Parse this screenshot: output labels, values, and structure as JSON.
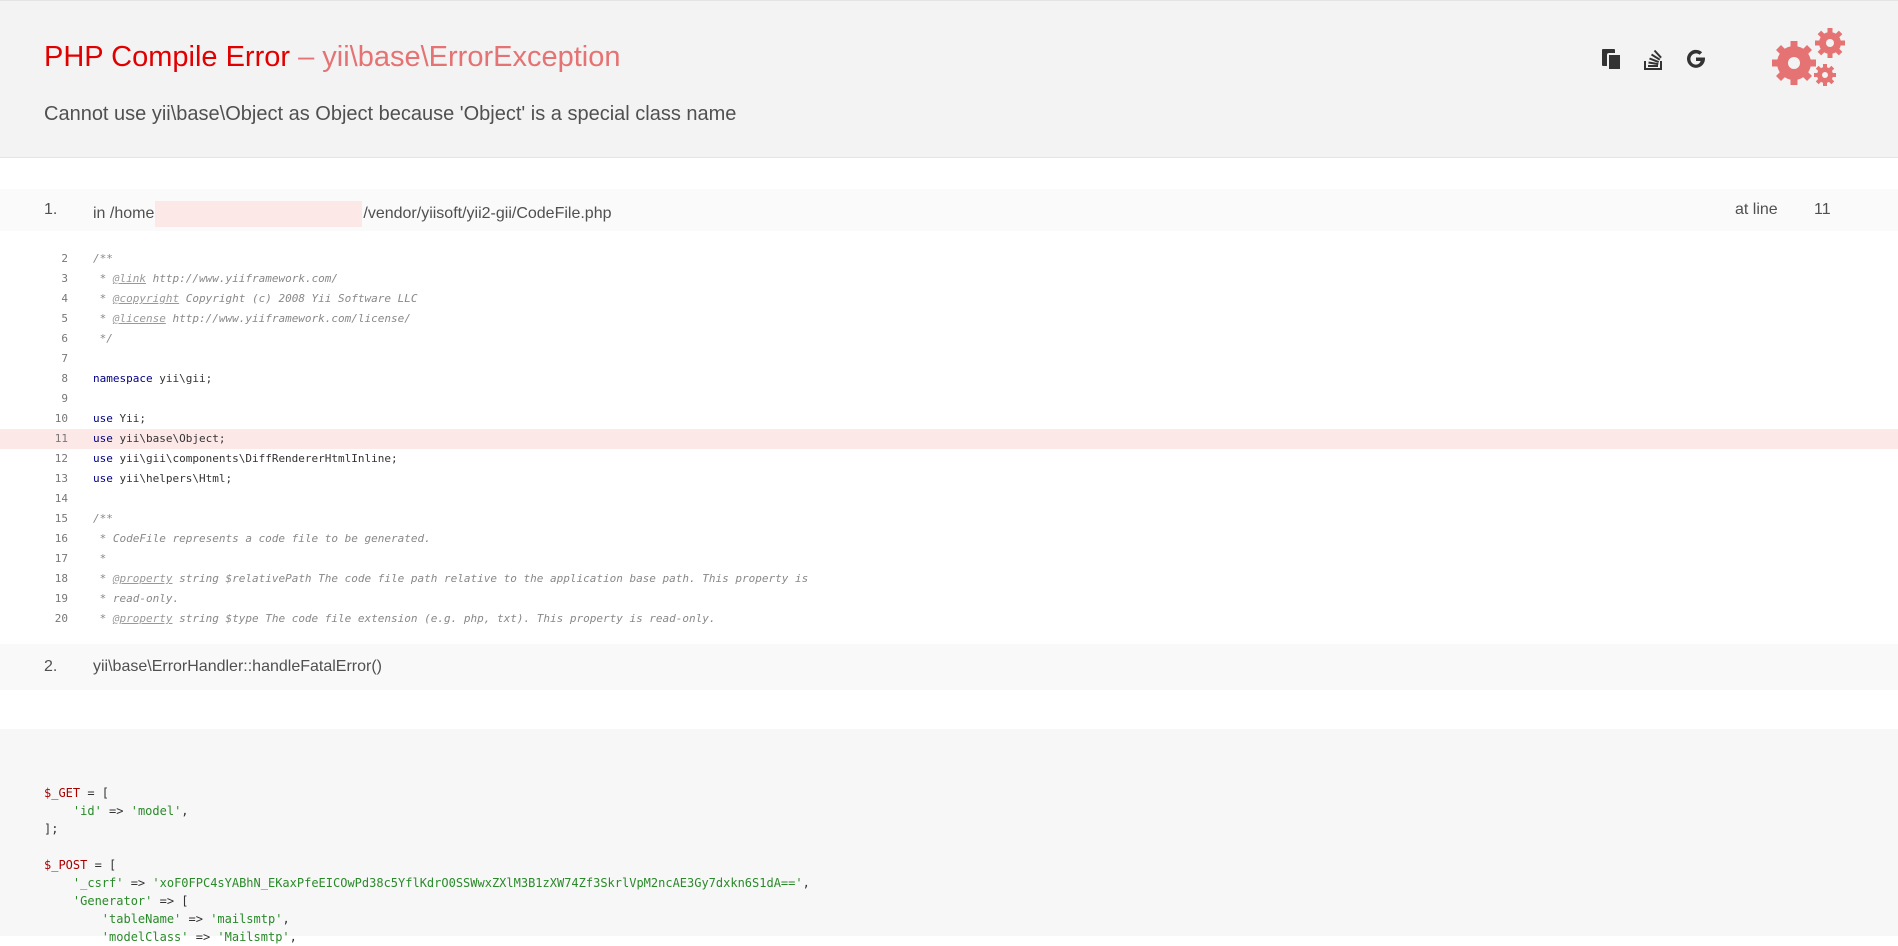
{
  "error": {
    "type": "PHP Compile Error",
    "separator": " – ",
    "exception_class": "yii\\base\\ErrorException",
    "message": "Cannot use yii\\base\\Object as Object because 'Object' is a special class name"
  },
  "toolbar": {
    "copy_icon": "copy-icon",
    "stackoverflow_icon": "stackoverflow-icon",
    "google_icon": "google-icon",
    "gears_icon": "gears-icon"
  },
  "call_stack": [
    {
      "number": "1.",
      "prefix": "in /home",
      "suffix": "/vendor/yiisoft/yii2-gii/CodeFile.php",
      "at_line_label": "at line",
      "line": "11"
    },
    {
      "number": "2.",
      "text": "yii\\base\\ErrorHandler::handleFatalError()"
    }
  ],
  "code_lines": [
    {
      "n": "2",
      "pre": "",
      "kw": "",
      "rest": "",
      "cm": "/**",
      "tag": "",
      "after": ""
    },
    {
      "n": "3",
      "pre": "",
      "kw": "",
      "rest": "",
      "cm": " * ",
      "tag": "@link",
      "after": " http://www.yiiframework.com/"
    },
    {
      "n": "4",
      "pre": "",
      "kw": "",
      "rest": "",
      "cm": " * ",
      "tag": "@copyright",
      "after": " Copyright (c) 2008 Yii Software LLC"
    },
    {
      "n": "5",
      "pre": "",
      "kw": "",
      "rest": "",
      "cm": " * ",
      "tag": "@license",
      "after": " http://www.yiiframework.com/license/"
    },
    {
      "n": "6",
      "pre": "",
      "kw": "",
      "rest": "",
      "cm": " */",
      "tag": "",
      "after": ""
    },
    {
      "n": "7",
      "pre": "",
      "kw": "",
      "rest": "",
      "cm": "",
      "tag": "",
      "after": ""
    },
    {
      "n": "8",
      "pre": "",
      "kw": "namespace",
      "rest": " yii\\gii;",
      "cm": "",
      "tag": "",
      "after": ""
    },
    {
      "n": "9",
      "pre": "",
      "kw": "",
      "rest": "",
      "cm": "",
      "tag": "",
      "after": ""
    },
    {
      "n": "10",
      "pre": "",
      "kw": "use",
      "rest": " Yii;",
      "cm": "",
      "tag": "",
      "after": ""
    },
    {
      "n": "11",
      "pre": "",
      "kw": "use",
      "rest": " yii\\base\\Object;",
      "cm": "",
      "tag": "",
      "after": "",
      "error": true
    },
    {
      "n": "12",
      "pre": "",
      "kw": "use",
      "rest": " yii\\gii\\components\\DiffRendererHtmlInline;",
      "cm": "",
      "tag": "",
      "after": ""
    },
    {
      "n": "13",
      "pre": "",
      "kw": "use",
      "rest": " yii\\helpers\\Html;",
      "cm": "",
      "tag": "",
      "after": ""
    },
    {
      "n": "14",
      "pre": "",
      "kw": "",
      "rest": "",
      "cm": "",
      "tag": "",
      "after": ""
    },
    {
      "n": "15",
      "pre": "",
      "kw": "",
      "rest": "",
      "cm": "/**",
      "tag": "",
      "after": ""
    },
    {
      "n": "16",
      "pre": "",
      "kw": "",
      "rest": "",
      "cm": " * CodeFile represents a code file to be generated.",
      "tag": "",
      "after": ""
    },
    {
      "n": "17",
      "pre": "",
      "kw": "",
      "rest": "",
      "cm": " *",
      "tag": "",
      "after": ""
    },
    {
      "n": "18",
      "pre": "",
      "kw": "",
      "rest": "",
      "cm": " * ",
      "tag": "@property",
      "after": " string $relativePath The code file path relative to the application base path. This property is"
    },
    {
      "n": "19",
      "pre": "",
      "kw": "",
      "rest": "",
      "cm": " * read-only.",
      "tag": "",
      "after": ""
    },
    {
      "n": "20",
      "pre": "",
      "kw": "",
      "rest": "",
      "cm": " * ",
      "tag": "@property",
      "after": " string $type The code file extension (e.g. php, txt). This property is read-only."
    }
  ],
  "request": {
    "get_var": "$_GET",
    "get_key": "'id'",
    "get_val": "'model'",
    "post_var": "$_POST",
    "csrf_key": "'_csrf'",
    "csrf_val": "'xoF0FPC4sYABhN_EKaxPfeEICOwPd38c5YflKdrO0SSWwxZXlM3B1zXW74Zf3SkrlVpM2ncAE3Gy7dxkn6S1dA=='",
    "generator_key": "'Generator'",
    "table_key": "'tableName'",
    "table_val": "'mailsmtp'",
    "model_key": "'modelClass'",
    "model_val": "'Mailsmtp'"
  },
  "colors": {
    "error_red": "#e10000",
    "exception_pink": "#e57373",
    "highlight_row": "#fde8e8"
  }
}
